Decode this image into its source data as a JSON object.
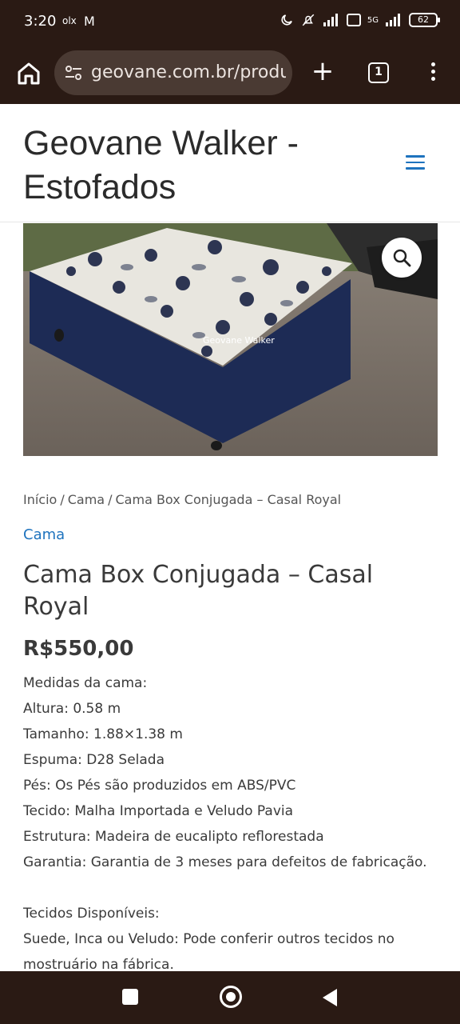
{
  "status_bar": {
    "time": "3:20",
    "notif_app": "olx",
    "mail_icon": "M",
    "network": "5G",
    "battery": "62"
  },
  "browser": {
    "url": "geovane.com.br/produto",
    "tab_count": "1"
  },
  "site": {
    "title": "Geovane Walker - Estofados"
  },
  "product_image": {
    "watermark": "Geovane Walker"
  },
  "breadcrumb": {
    "items": [
      "Início",
      "Cama",
      "Cama Box Conjugada – Casal Royal"
    ],
    "separator": "/"
  },
  "product": {
    "category": "Cama",
    "title": "Cama Box Conjugada – Casal Royal",
    "price": "R$550,00",
    "description": [
      "Medidas da cama:",
      "Altura: 0.58 m",
      "Tamanho: 1.88×1.38 m",
      "Espuma: D28 Selada",
      "Pés: Os Pés são produzidos em ABS/PVC",
      "Tecido: Malha Importada e Veludo Pavia",
      "Estrutura: Madeira de eucalipto reflorestada",
      "Garantia: Garantia de 3 meses para defeitos de fabricação."
    ],
    "tecidos_heading": "Tecidos Disponíveis:",
    "tecidos_text": "Suede, Inca ou Veludo: Pode conferir outros tecidos no mostruário na fábrica."
  },
  "colors": {
    "system_bar": "#2a1a14",
    "url_pill": "#4a3a33",
    "link_blue": "#1e73be",
    "text": "#3a3a3a"
  }
}
